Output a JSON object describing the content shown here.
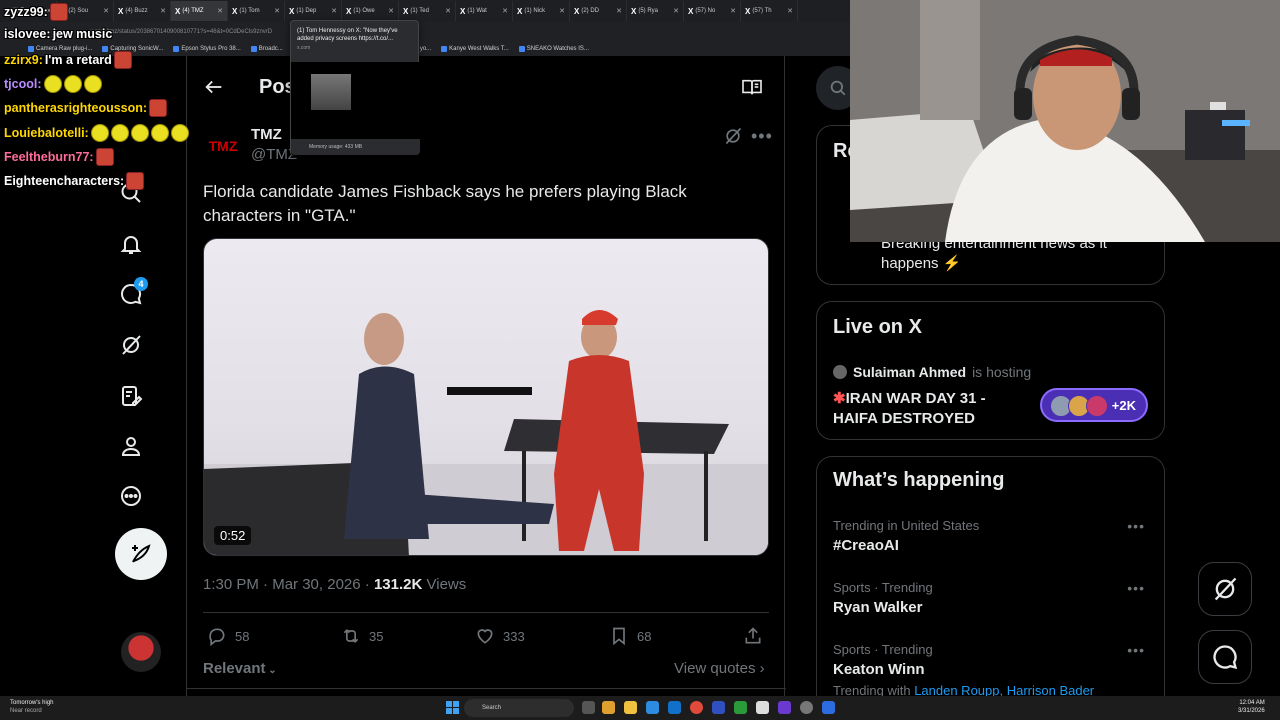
{
  "browser": {
    "tabs": [
      {
        "label": "(1) Zyzz",
        "active": false
      },
      {
        "label": "(2) Sou",
        "active": false
      },
      {
        "label": "(4) Buzz",
        "active": false
      },
      {
        "label": "(4) TMZ",
        "active": true
      },
      {
        "label": "(1) Tom",
        "active": false
      },
      {
        "label": "(1) Dep",
        "active": false
      },
      {
        "label": "(1) Owe",
        "active": false
      },
      {
        "label": "(1) Ted",
        "active": false
      },
      {
        "label": "(1) Wat",
        "active": false
      },
      {
        "label": "(1) Nick",
        "active": false
      },
      {
        "label": "(2) DD",
        "active": false
      },
      {
        "label": "(5) Rya",
        "active": false
      },
      {
        "label": "(57) No",
        "active": false
      },
      {
        "label": "(57) Th",
        "active": false
      }
    ],
    "url": "x.com/tmz/status/2038670140900810771?s=46&t=0CdDeCls9znvrD",
    "bookmarks": [
      "Camera Raw plug-i...",
      "Capturing SonicW...",
      "Epson Stylus Pro 38...",
      "Broadc...",
      "Fame - Google Docs",
      "Item shared with yo...",
      "Kanye West Walks T...",
      "SNEAKO Watches IS..."
    ],
    "tab_preview": {
      "title": "(1) Tom Hennessy on X: \"Now they've added privacy screens https://t.co/...",
      "domain": "x.com",
      "memory": "Memory usage: 433 MB"
    }
  },
  "chat": [
    {
      "user": "zyzz99:",
      "color": "#ffffff",
      "message": "",
      "emotes": 1
    },
    {
      "user": "islovee:",
      "color": "#ffffff",
      "message": "jew music",
      "emotes": 0
    },
    {
      "user": "zzirx9:",
      "color": "#ffd700",
      "message": "I'm a retard",
      "emotes": 1
    },
    {
      "user": "tjcool:",
      "color": "#b98cff",
      "message": "",
      "emotes": 3
    },
    {
      "user": "pantherasrighteousson:",
      "color": "#ffd700",
      "message": "",
      "emotes": 1
    },
    {
      "user": "Louiebalotelli:",
      "color": "#ffd700",
      "message": "",
      "emotes": 5
    },
    {
      "user": "Feeltheburn77:",
      "color": "#ff6b9a",
      "message": "",
      "emotes": 1
    },
    {
      "user": "Eighteencharacters:",
      "color": "#ffffff",
      "message": "",
      "emotes": 1
    }
  ],
  "nav": {
    "notifications_badge": "4",
    "icons": [
      "search-icon",
      "bell-icon",
      "messages-icon",
      "grok-icon",
      "lists-icon",
      "profile-icon",
      "more-icon"
    ]
  },
  "post": {
    "header_title": "Post",
    "author_name": "TMZ",
    "author_handle": "@TMZ",
    "avatar_text": "TMZ",
    "text": "Florida candidate James Fishback says he prefers playing Black characters in \"GTA.\"",
    "video_duration": "0:52",
    "time": "1:30 PM",
    "date": "Mar 30, 2026",
    "views_count": "131.2K",
    "views_label": "Views",
    "replies": "58",
    "reposts": "35",
    "likes": "333",
    "bookmarks": "68",
    "sort_label": "Relevant",
    "view_quotes": "View quotes"
  },
  "sidebar": {
    "relevant_title": "Re",
    "tmz_bio": "Breaking entertainment news as it happens ⚡",
    "live": {
      "title": "Live on X",
      "host": "Sulaiman Ahmed",
      "host_suffix": "is hosting",
      "space_title": "IRAN WAR DAY 31 - HAIFA DESTROYED",
      "listeners": "+2K"
    },
    "happening": {
      "title": "What’s happening",
      "trends": [
        {
          "context": "Trending in United States",
          "name": "#CreaoAI"
        },
        {
          "context": "Sports · Trending",
          "name": "Ryan Walker"
        },
        {
          "context": "Sports · Trending",
          "name": "Keaton Winn"
        }
      ],
      "trending_with_label": "Trending with",
      "trending_with_names": "Landen Roupp, Harrison Bader"
    }
  },
  "taskbar": {
    "weather_title": "Tomorrow's high",
    "weather_sub": "Near record",
    "search_placeholder": "Search",
    "time": "12:04 AM",
    "date": "3/31/2026"
  },
  "colors": {
    "accent": "#1d9bf0",
    "background": "#000000",
    "border": "#2f3336",
    "muted_text": "#71767b",
    "space_pill": "#4a2fb5"
  }
}
